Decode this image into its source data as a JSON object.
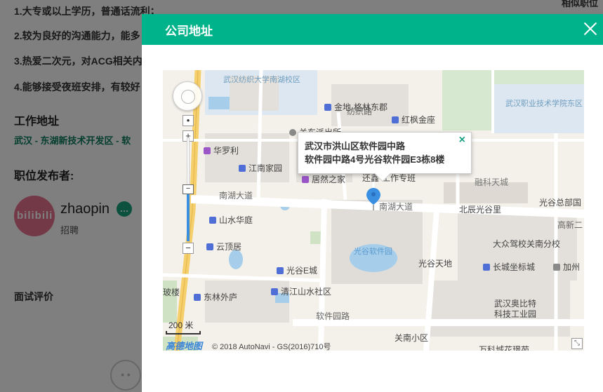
{
  "background_page": {
    "requirements": [
      "1.大专或以上学历，普通话流利；",
      "2.较为良好的沟通能力，能多",
      "3.热爱二次元，对ACG相关内",
      "4.能够接受夜班安排，有较好"
    ],
    "right_header": "相似职位",
    "work_location_title": "工作地址",
    "work_location": "武汉 - 东湖新技术开发区 - 软",
    "publisher_title": "职位发布者:",
    "publisher_name": "zhaopin",
    "publisher_role": "招聘",
    "avatar_text": "bilibili",
    "interview_title": "面试评价"
  },
  "modal": {
    "title": "公司地址",
    "info_window": {
      "line1": "武汉市洪山区软件园中路",
      "line2": "软件园中路4号光谷软件园E3栋8楼",
      "close_symbol": "×"
    },
    "map": {
      "scale_label": "200 米",
      "brand": "高德地图",
      "copyright": "© 2018 AutoNavi - GS(2016)710号",
      "zoom_in": "+",
      "zoom_out": "−",
      "zoom_level_fraction": 0.5,
      "places": {
        "p_jindi": "金地·格林东郡",
        "p_fangzhi": "纺织路",
        "p_hongfeng": "红枫金座",
        "p_guandong": "关东派出所",
        "p_huaroli": "华罗利",
        "p_jiangnan": "江南家园",
        "p_jurang": "居然之家",
        "p_huanya": "还鑫",
        "p_gongzuo": "工作专班",
        "p_rongke": "融科天城",
        "p_nanhu1": "南湖大道",
        "p_nanhu2": "南湖大道",
        "p_beichen": "北辰光谷里",
        "p_guanggu_zb": "光谷总部国",
        "p_shanshui": "山水华庭",
        "p_gaoxin": "高新二",
        "p_yunding": "云顶居",
        "p_softpark": "光谷软件园",
        "p_dazhong": "大众驾校关南分校",
        "p_eCity": "光谷E城",
        "p_tiandi": "光谷天地",
        "p_changcheng": "长城坐标城",
        "p_jiazhou": "加州",
        "p_bolou": "玻楼",
        "p_donglin": "东林外庐",
        "p_qingjiang": "清江山水社区",
        "p_softroad": "软件园路",
        "p_aobit": "武汉奥比特",
        "p_aobit2": "科技工业园",
        "p_guannan": "关南小区",
        "p_kejicheng": "万科城花璟苑",
        "campus1": "武汉纺织大学南湖校区",
        "campus2": "武汉职业技术学院东区"
      }
    }
  }
}
